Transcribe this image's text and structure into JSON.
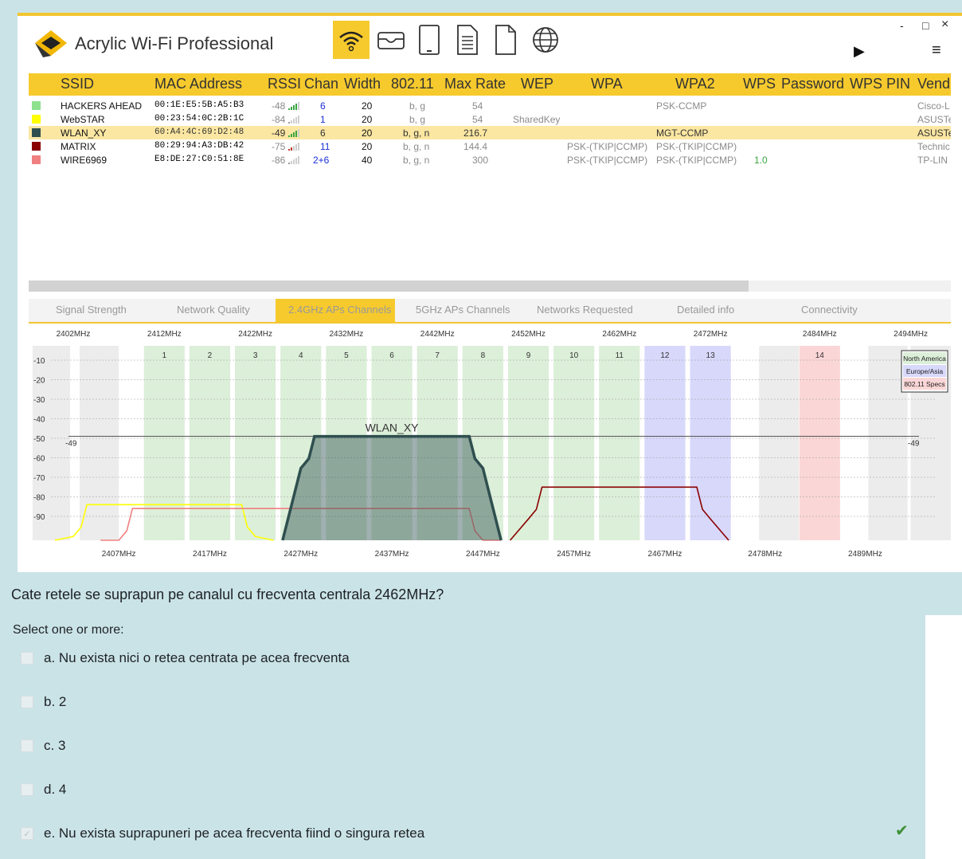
{
  "app": {
    "title": "Acrylic Wi-Fi Professional",
    "toolbar_icons": [
      "wifi-icon",
      "inbox-icon",
      "tablet-icon",
      "document-icon",
      "file-icon",
      "globe-icon"
    ],
    "window_controls": {
      "minimize": "-",
      "maximize": "□",
      "close": "×"
    },
    "play_icon": "▶",
    "menu_icon": "≡"
  },
  "table": {
    "columns": [
      "SSID",
      "MAC Address",
      "RSSI",
      "Chan",
      "Width",
      "802.11",
      "Max Rate",
      "WEP",
      "WPA",
      "WPA2",
      "WPS",
      "Password",
      "WPS PIN",
      "Vend"
    ],
    "rows": [
      {
        "color": "#8ee28e",
        "ssid": "HACKERS AHEAD",
        "mac": "00:1E:E5:5B:A5:B3",
        "rssi": "-48",
        "chan": "6",
        "width": "20",
        "std": "b, g",
        "rate": "54",
        "wep": "",
        "wpa": "",
        "wpa2": "PSK-CCMP",
        "wps": "",
        "vendor": "Cisco-L"
      },
      {
        "color": "#ffff00",
        "ssid": "WebSTAR",
        "mac": "00:23:54:0C:2B:1C",
        "rssi": "-84",
        "chan": "1",
        "width": "20",
        "std": "b, g",
        "rate": "54",
        "wep": "SharedKey",
        "wpa": "",
        "wpa2": "",
        "wps": "",
        "vendor": "ASUSTe"
      },
      {
        "color": "#2f4f4f",
        "ssid": "WLAN_XY",
        "mac": "60:A4:4C:69:D2:48",
        "rssi": "-49",
        "chan": "6",
        "width": "20",
        "std": "b, g, n",
        "rate": "216.7",
        "wep": "",
        "wpa": "",
        "wpa2": "MGT-CCMP",
        "wps": "",
        "vendor": "ASUSTe"
      },
      {
        "color": "#8b0000",
        "ssid": "MATRIX",
        "mac": "80:29:94:A3:DB:42",
        "rssi": "-75",
        "chan": "11",
        "width": "20",
        "std": "b, g, n",
        "rate": "144.4",
        "wep": "",
        "wpa": "PSK-(TKIP|CCMP)",
        "wpa2": "PSK-(TKIP|CCMP)",
        "wps": "",
        "vendor": "Technic"
      },
      {
        "color": "#f08080",
        "ssid": "WIRE6969",
        "mac": "E8:DE:27:C0:51:8E",
        "rssi": "-86",
        "chan": "2+6",
        "width": "40",
        "std": "b, g, n",
        "rate": "300",
        "wep": "",
        "wpa": "PSK-(TKIP|CCMP)",
        "wpa2": "PSK-(TKIP|CCMP)",
        "wps": "1.0",
        "vendor": "TP-LIN"
      }
    ]
  },
  "tabs": [
    "Signal Strength",
    "Network Quality",
    "2.4GHz APs Channels",
    "5GHz APs Channels",
    "Networks Requested",
    "Detailed info",
    "Connectivity"
  ],
  "chart_data": {
    "type": "area",
    "title": "",
    "top_freqs": [
      "2402MHz",
      "2412MHz",
      "2422MHz",
      "2432MHz",
      "2442MHz",
      "2452MHz",
      "2462MHz",
      "2472MHz",
      "2484MHz",
      "2494MHz"
    ],
    "bottom_freqs": [
      "2407MHz",
      "2417MHz",
      "2427MHz",
      "2437MHz",
      "2447MHz",
      "2457MHz",
      "2467MHz",
      "2478MHz",
      "2489MHz"
    ],
    "channels": [
      "1",
      "2",
      "3",
      "4",
      "5",
      "6",
      "7",
      "8",
      "9",
      "10",
      "11",
      "12",
      "13",
      "14"
    ],
    "y_ticks": [
      "-10",
      "-20",
      "-30",
      "-40",
      "-50",
      "-60",
      "-70",
      "-80",
      "-90"
    ],
    "ylim": [
      -100,
      0
    ],
    "legend": [
      "North America",
      "Europe/Asia",
      "802.11 Specs"
    ],
    "legend_colors": [
      "#dcefd9",
      "#d8d8fb",
      "#fbd6d6"
    ],
    "reference_line": {
      "value": -49,
      "label_left": "-49",
      "label_right": "-49"
    },
    "series": [
      {
        "name": "WLAN_XY",
        "channel": 6,
        "width_mhz": 20,
        "rssi": -49,
        "color": "#2f4f4f"
      },
      {
        "name": "WebSTAR",
        "channel": 1,
        "width_mhz": 20,
        "rssi": -84,
        "color": "#ffff00"
      },
      {
        "name": "WIRE6969",
        "channel": 4,
        "width_mhz": 40,
        "rssi": -86,
        "color": "#f08080"
      },
      {
        "name": "MATRIX",
        "channel": 11,
        "width_mhz": 20,
        "rssi": -75,
        "color": "#8b0000"
      }
    ]
  },
  "quiz": {
    "question": "Cate retele se suprapun pe canalul cu frecventa centrala 2462MHz?",
    "select_label": "Select one or more:",
    "options": [
      {
        "label": "a. Nu exista nici o retea centrata pe acea frecventa",
        "checked": false
      },
      {
        "label": "b. 2",
        "checked": false
      },
      {
        "label": "c. 3",
        "checked": false
      },
      {
        "label": "d. 4",
        "checked": false
      },
      {
        "label": "e. Nu exista suprapuneri pe acea frecventa fiind o singura retea",
        "checked": true
      }
    ],
    "correct_mark": "✔"
  }
}
